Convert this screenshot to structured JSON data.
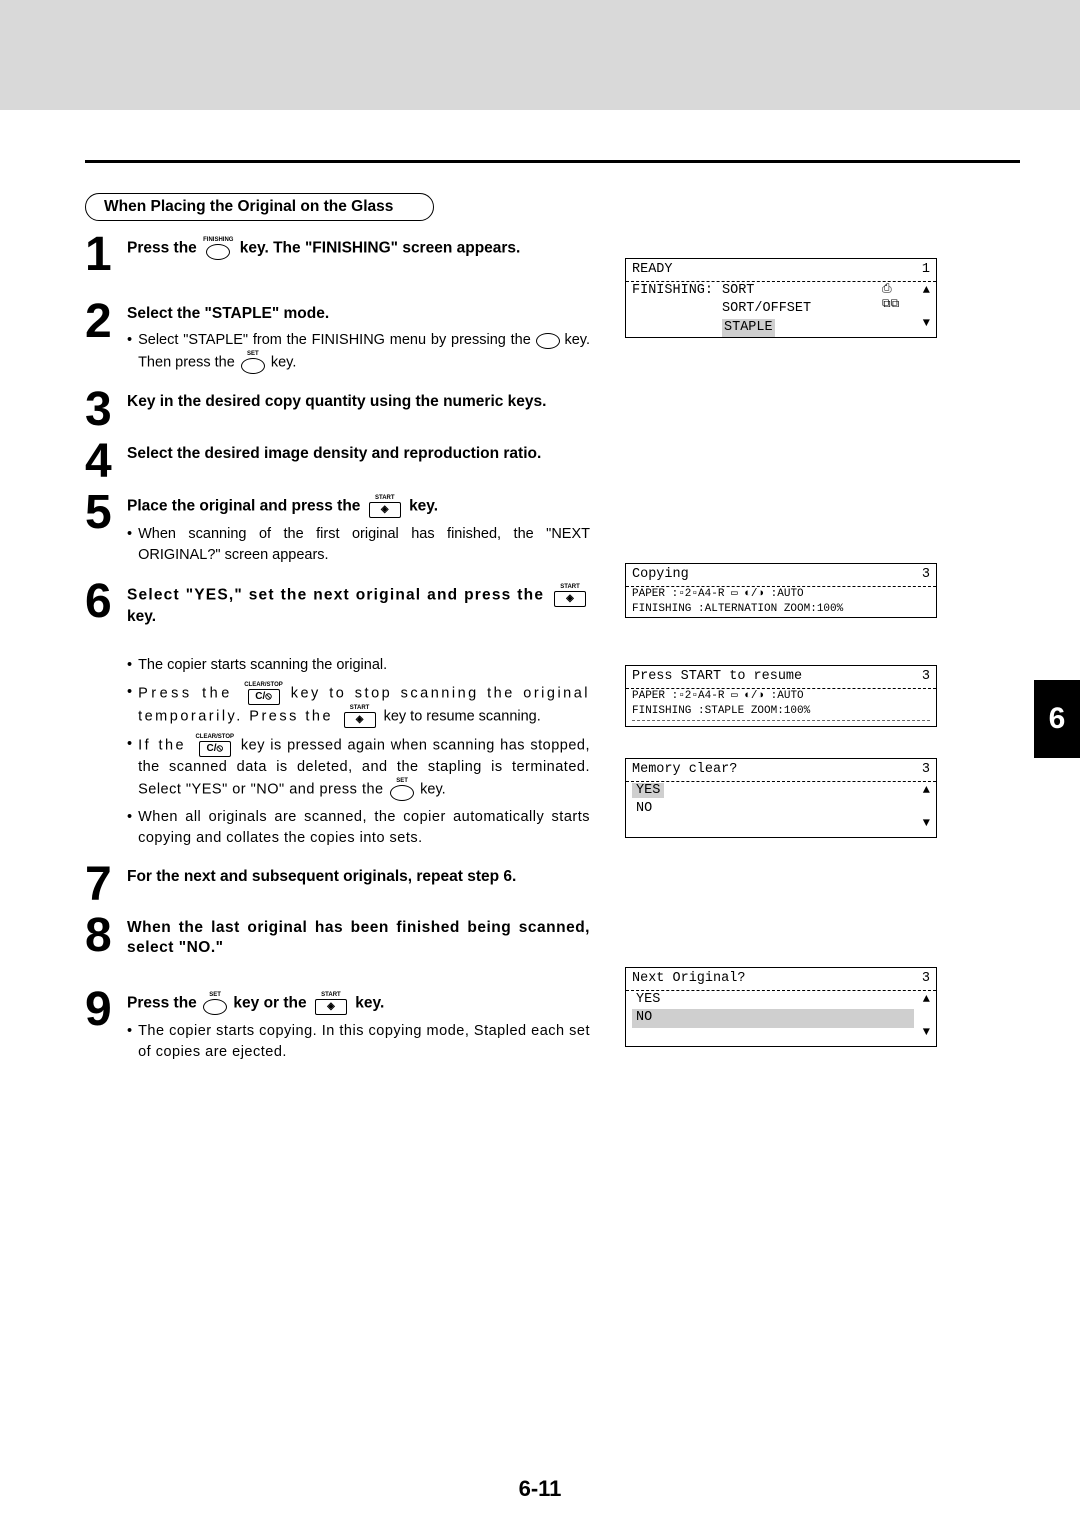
{
  "header_title": "When Placing the Original on the Glass",
  "chapter_tab": "6",
  "page_number": "6-11",
  "labels": {
    "finishing": "FINISHING",
    "set": "SET",
    "start": "START",
    "clearstop": "CLEAR/STOP",
    "cslash": "C/⦸"
  },
  "steps": {
    "s1": {
      "n": "1",
      "title_a": "Press the ",
      "title_b": " key. The \"FINISHING\" screen appears."
    },
    "s2": {
      "n": "2",
      "title": "Select the \"STAPLE\" mode.",
      "b1a": "Select \"STAPLE\" from the FINISHING menu by pressing the ",
      "b1b": " key. Then press the ",
      "b1c": " key."
    },
    "s3": {
      "n": "3",
      "title": "Key in the desired copy quantity using the numeric keys."
    },
    "s4": {
      "n": "4",
      "title": "Select the desired image density and reproduction ratio."
    },
    "s5": {
      "n": "5",
      "title_a": "Place the original and press the ",
      "title_b": " key.",
      "b1": "When scanning of the first original has finished, the \"NEXT ORIGINAL?\" screen appears."
    },
    "s6": {
      "n": "6",
      "title_a": "Select \"YES,\" set the next original and press the ",
      "title_b": " key.",
      "b1": "The copier starts scanning the original.",
      "b2a": "Press the ",
      "b2b": " key to stop scanning the original temporarily.  Press the ",
      "b2c": " key to resume scanning.",
      "b3a": "If the ",
      "b3b": " key is pressed again when scanning has stopped, the scanned data is deleted, and the stapling is terminated.  Select \"YES\" or \"NO\" and press the ",
      "b3c": " key.",
      "b4": "When all originals are scanned, the copier automatically starts copying and collates the copies into sets."
    },
    "s7": {
      "n": "7",
      "title": "For the next and subsequent originals, repeat step 6."
    },
    "s8": {
      "n": "8",
      "title": "When the last original has been finished being scanned, select \"NO.\""
    },
    "s9": {
      "n": "9",
      "title_a": "Press the ",
      "title_b": " key or the ",
      "title_c": " key.",
      "b1": "The copier starts copying.  In this copying mode, Stapled each set of copies are ejected."
    }
  },
  "lcd1": {
    "ready": "READY",
    "count": "1",
    "label": "FINISHING:",
    "opt1": "SORT",
    "opt2": "SORT/OFFSET",
    "opt3": "STAPLE"
  },
  "lcd2": {
    "title": "Copying",
    "count": "3",
    "line2": "PAPER     :▫2▫A4-R ▭ ◐/◑ :AUTO",
    "line3": "FINISHING :ALTERNATION ZOOM:100%"
  },
  "lcd3": {
    "title": "Press START to resume",
    "count": "3",
    "line2": "PAPER     :▫2▫A4-R ▭ ◐/◑ :AUTO",
    "line3": "FINISHING :STAPLE    ZOOM:100%"
  },
  "lcd4": {
    "title": "Memory clear?",
    "count": "3",
    "yes": "YES",
    "no": "NO"
  },
  "lcd5": {
    "title": "Next Original?",
    "count": "3",
    "yes": "YES",
    "no": "NO"
  }
}
